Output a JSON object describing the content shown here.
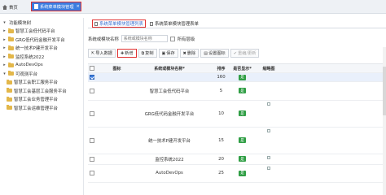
{
  "top_tabs": {
    "home": "首页",
    "active": "系统菜单模块管理",
    "active_close": "×"
  },
  "sidebar": {
    "title": "功能模块树",
    "items": [
      {
        "label": "智慧工会低代码平台",
        "level": 0
      },
      {
        "label": "GRG低代码金融开发平台",
        "level": 0
      },
      {
        "label": "统一技术P建开发平台",
        "level": 0
      },
      {
        "label": "监控系统2022",
        "level": 0
      },
      {
        "label": "AutoDevOps",
        "level": 0
      },
      {
        "label": "可观测平台",
        "level": 0
      },
      {
        "label": "智慧工会职工服务平台",
        "level": 1
      },
      {
        "label": "智慧工会基层工会服务平台",
        "level": 1
      },
      {
        "label": "智慧工会业务管理平台",
        "level": 1
      },
      {
        "label": "智慧工会运维管理平台",
        "level": 1
      }
    ]
  },
  "main_tabs": {
    "list": "系统菜单模块管理列表",
    "form": "系统菜单模块管理表单"
  },
  "filter": {
    "label": "系统或模块名称",
    "placeholder": "系统或模块名称",
    "all_levels": "所有层级"
  },
  "toolbar": {
    "import": "导入数据",
    "add": "新增",
    "copy": "复制",
    "save": "保存",
    "delete": "删除",
    "settings": "设置图标",
    "recompile": "重编/更新"
  },
  "grid": {
    "headers": {
      "icon": "图标",
      "name": "系统或模块名称*",
      "sort": "排序",
      "show": "是否显示*",
      "thumb": "缩略图"
    },
    "rows": [
      {
        "name": "",
        "sort": "160",
        "show": "是"
      },
      {
        "name": "智慧工会低代码平台",
        "sort": "5",
        "show": "是"
      },
      {
        "name": "GRG低代码金融开发平台",
        "sort": "10",
        "show": "是"
      },
      {
        "name": "统一技术P建开发平台",
        "sort": "15",
        "show": "是"
      },
      {
        "name": "监控系统2022",
        "sort": "20",
        "show": "是"
      },
      {
        "name": "AutoDevOps",
        "sort": "25",
        "show": "是"
      }
    ]
  },
  "colors": {
    "accent": "#3b7de0",
    "highlight": "#e03030",
    "badge": "#2f9e44",
    "folder": "#e3b74a"
  }
}
